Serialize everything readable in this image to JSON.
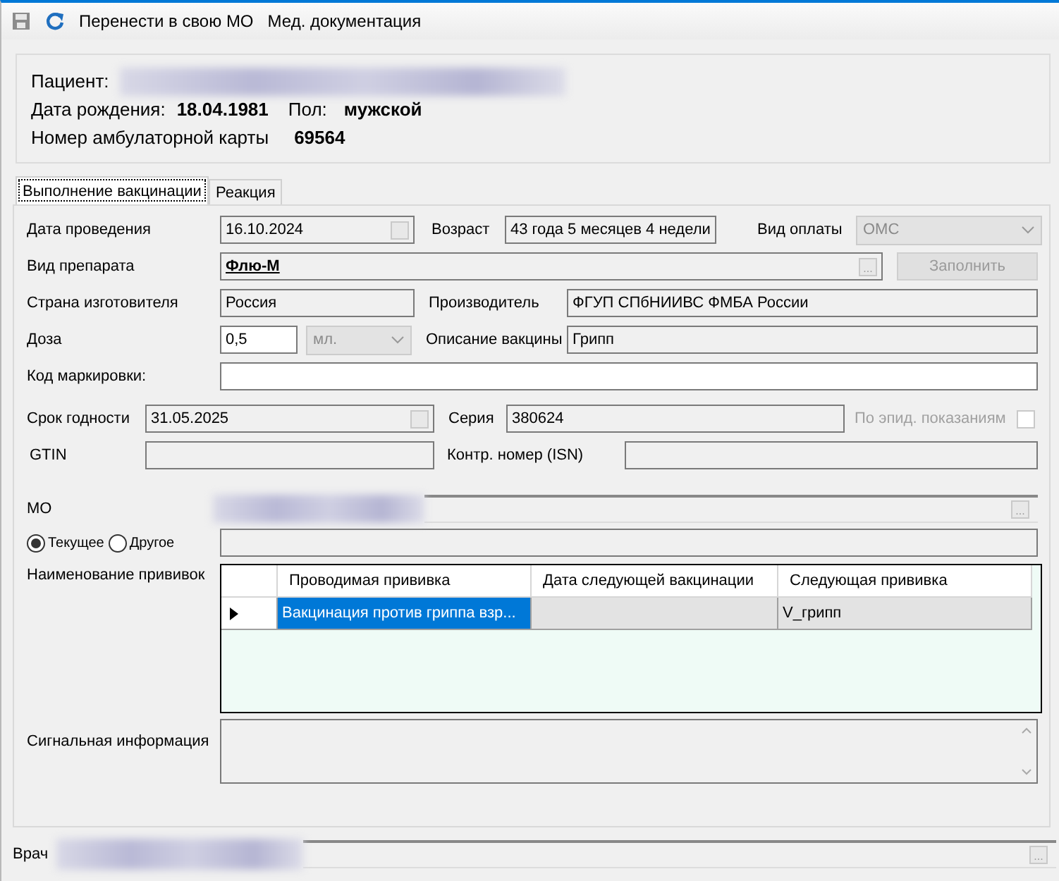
{
  "toolbar": {
    "buttons": [
      {
        "kind": "save",
        "disabled": true
      },
      {
        "kind": "refresh",
        "disabled": false
      },
      {
        "kind": "text",
        "label": "Перенести в свою МО"
      },
      {
        "kind": "text",
        "label": "Мед. документация"
      }
    ]
  },
  "patient": {
    "name_label": "Пациент:",
    "birth_label": "Дата рождения:",
    "birth_date": "18.04.1981",
    "sex_label": "Пол:",
    "sex": "мужской",
    "card_label": "Номер амбулаторной карты",
    "card_number": "69564"
  },
  "tabs": [
    {
      "label": "Выполнение вакцинации",
      "selected": true
    },
    {
      "label": "Реакция",
      "selected": false
    }
  ],
  "form": {
    "date_label": "Дата проведения",
    "date": "16.10.2024",
    "age_label": "Возраст",
    "age": "43 года 5 месяцев 4 недели",
    "payment_label": "Вид оплаты",
    "payment": "ОМС",
    "drug_label": "Вид препарата",
    "drug": "Флю-М",
    "fill_button": "Заполнить",
    "browse": "...",
    "country_label": "Страна изготовителя",
    "country": "Россия",
    "maker_label": "Производитель",
    "maker": "ФГУП СПбНИИВС ФМБА России",
    "dose_label": "Доза",
    "dose": "0,5",
    "unit": "мл.",
    "description_label": "Описание вакцины",
    "description": "Грипп",
    "marking_label": "Код маркировки:",
    "expiry_label": "Срок годности",
    "expiry": "31.05.2025",
    "series_label": "Серия",
    "series": "380624",
    "epid": {
      "label": "По эпид. показаниям",
      "checked": false,
      "disabled": true
    },
    "gtin_label": "GTIN",
    "isn_label": "Контр. номер (ISN)",
    "mo_label": "МО",
    "mo_browse": "...",
    "mo_options": [
      {
        "label": "Текущее",
        "selected": true
      },
      {
        "label": "Другое",
        "selected": false
      }
    ],
    "vaccinations_label": "Наименование прививок",
    "grid": {
      "columns": [
        "Проводимая прививка",
        "Дата следующей вакцинации",
        "Следующая прививка"
      ],
      "rows": [
        {
          "current": true,
          "cells": [
            {
              "text": "Вакцинация против гриппа взр...",
              "selected": true
            },
            {
              "text": "",
              "selected": false
            },
            {
              "text": "V_грипп",
              "selected": false
            }
          ]
        }
      ]
    },
    "signal_label": "Сигнальная информация"
  },
  "doctor": {
    "label": "Врач",
    "browse": "..."
  }
}
